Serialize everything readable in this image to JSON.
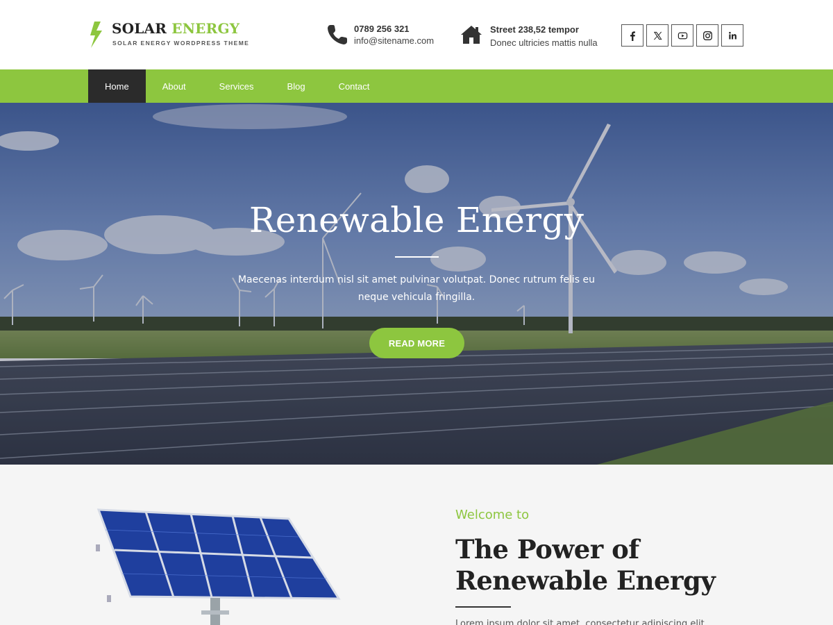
{
  "brand": {
    "title_part1": "SOLAR",
    "title_part2": "ENERGY",
    "tagline": "SOLAR ENERGY WORDPRESS THEME",
    "accent_color": "#8dc63f"
  },
  "contact": {
    "phone": "0789 256 321",
    "email": "info@sitename.com",
    "address_line1": "Street 238,52 tempor",
    "address_line2": "Donec ultricies mattis nulla"
  },
  "socials": [
    {
      "icon": "facebook-icon"
    },
    {
      "icon": "x-icon"
    },
    {
      "icon": "youtube-icon"
    },
    {
      "icon": "instagram-icon"
    },
    {
      "icon": "linkedin-icon"
    }
  ],
  "nav": {
    "items": [
      {
        "label": "Home",
        "active": true
      },
      {
        "label": "About",
        "active": false
      },
      {
        "label": "Services",
        "active": false
      },
      {
        "label": "Blog",
        "active": false
      },
      {
        "label": "Contact",
        "active": false
      }
    ],
    "background": "#8dc63f",
    "active_background": "#2b2b2b"
  },
  "hero": {
    "title": "Renewable Energy",
    "text": "Maecenas interdum nisl sit amet pulvinar volutpat. Donec rutrum felis eu neque vehicula fringilla.",
    "button_label": "READ MORE"
  },
  "about": {
    "eyebrow": "Welcome to",
    "title": "The Power of Renewable Energy",
    "body": "Lorem ipsum dolor sit amet, consectetur adipiscing elit."
  }
}
